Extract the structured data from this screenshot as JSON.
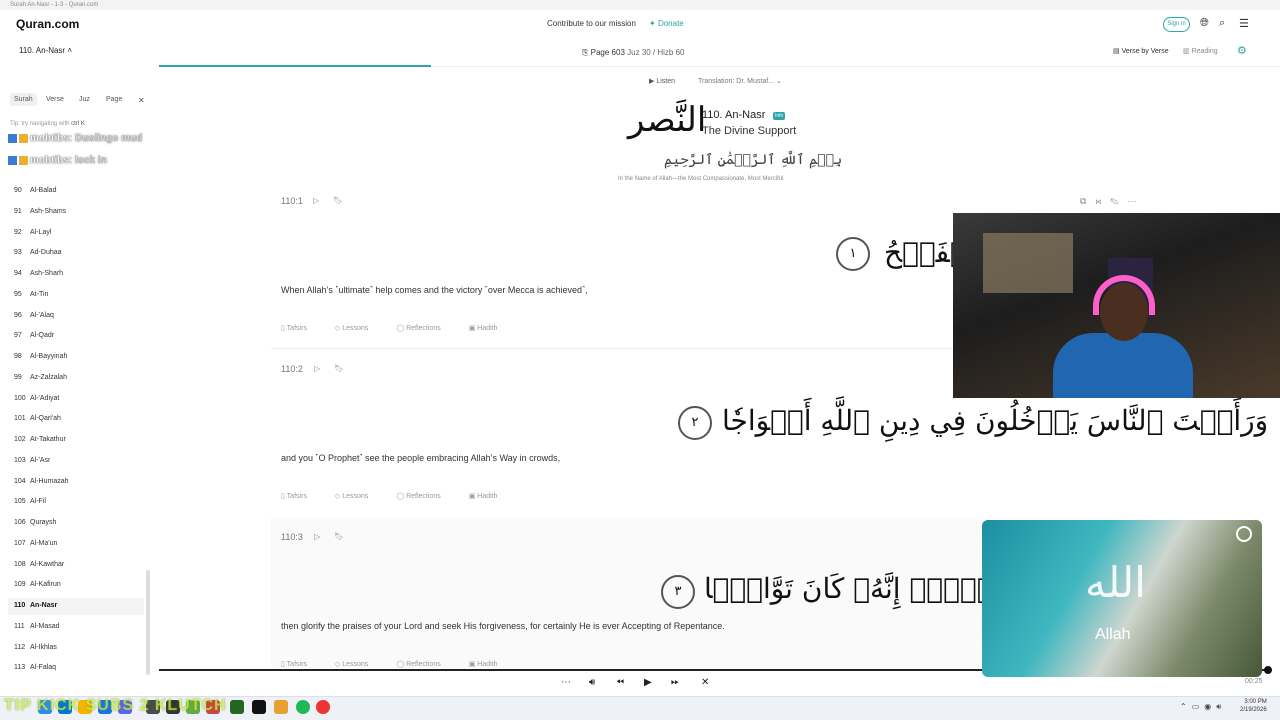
{
  "browser": {
    "title": "Surah An-Nasr - 1-3 - Quran.com"
  },
  "header": {
    "logo": "Quran.com",
    "contribute": "Contribute to our mission",
    "donate": "Donate",
    "signin": "Sign in",
    "surah_select": "110. An-Nasr",
    "page": "Page 603",
    "juz_hizb": "Juz 30 / Hizb 60",
    "verse_by_verse": "Verse by Verse",
    "reading": "Reading",
    "reading_progress": 0.243
  },
  "sidebar": {
    "tabs": [
      "Surah",
      "Verse",
      "Juz",
      "Page"
    ],
    "tip": "Tip: try navigating with",
    "tip_key": "ctrl K",
    "chat": [
      {
        "user": "mobtibs",
        "message": "Duolingo mud"
      },
      {
        "user": "mobtibs",
        "message": "lock in"
      }
    ],
    "items": [
      {
        "num": "90",
        "name": "Al-Balad"
      },
      {
        "num": "91",
        "name": "Ash-Shams"
      },
      {
        "num": "92",
        "name": "Al-Layl"
      },
      {
        "num": "93",
        "name": "Ad-Duhaa"
      },
      {
        "num": "94",
        "name": "Ash-Sharh"
      },
      {
        "num": "95",
        "name": "At-Tin"
      },
      {
        "num": "96",
        "name": "Al-'Alaq"
      },
      {
        "num": "97",
        "name": "Al-Qadr"
      },
      {
        "num": "98",
        "name": "Al-Bayyinah"
      },
      {
        "num": "99",
        "name": "Az-Zalzalah"
      },
      {
        "num": "100",
        "name": "Al-'Adiyat"
      },
      {
        "num": "101",
        "name": "Al-Qari'ah"
      },
      {
        "num": "102",
        "name": "At-Takathur"
      },
      {
        "num": "103",
        "name": "Al-'Asr"
      },
      {
        "num": "104",
        "name": "Al-Humazah"
      },
      {
        "num": "105",
        "name": "Al-Fil"
      },
      {
        "num": "106",
        "name": "Quraysh"
      },
      {
        "num": "107",
        "name": "Al-Ma'un"
      },
      {
        "num": "108",
        "name": "Al-Kawthar"
      },
      {
        "num": "109",
        "name": "Al-Kafirun"
      },
      {
        "num": "110",
        "name": "An-Nasr",
        "active": true
      },
      {
        "num": "111",
        "name": "Al-Masad"
      },
      {
        "num": "112",
        "name": "Al-Ikhlas"
      },
      {
        "num": "113",
        "name": "Al-Falaq"
      }
    ]
  },
  "surah": {
    "listen": "Listen",
    "translation": "Translation: Dr. Mustaf...",
    "calligraphy": "النَّصر",
    "title": "110. An-Nasr",
    "info": "Info",
    "subtitle": "The Divine Support",
    "bismillah_ar": "بِسۡمِ ٱللَّهِ ٱلرَّحۡمَٰنِ ٱلرَّحِيمِ",
    "bismillah_en": "In the Name of Allah—the Most Compassionate, Most Merciful"
  },
  "verses": [
    {
      "key": "110:1",
      "arabic": "لۡفَتۡحُ",
      "marker": "١",
      "translation": "When Allah’s ˹ultimate˺ help comes and the victory ˹over Mecca is achieved˺,"
    },
    {
      "key": "110:2",
      "arabic": "وَرَأَيۡتَ ٱلنَّاسَ يَدۡخُلُونَ فِي دِينِ ٱللَّهِ أَفۡوَاجٗا",
      "marker": "٢",
      "translation": "and you ˹O Prophet˺ see the people embracing Allah’s Way in crowds,"
    },
    {
      "key": "110:3",
      "arabic": "وَٱسۡتَغۡفِرۡهُۚ إِنَّهُۥ كَانَ تَوَّابَۢا",
      "marker": "٣",
      "translation": "then glorify the praises of your Lord and seek His forgiveness, for certainly He is ever Accepting of Repentance."
    }
  ],
  "verse_actions": [
    "Tafsirs",
    "Lessons",
    "Reflections",
    "Hadith"
  ],
  "player": {
    "time": "00:25"
  },
  "overlay": {
    "ar": "الله",
    "label": "Allah"
  },
  "taskbar": {
    "stream_text": "TIP KICK SUBS 2 KLUTCH",
    "clock_time": "3:00 PM",
    "clock_date": "2/19/2026"
  },
  "colors": {
    "accent": "#2ca4ab",
    "overlay_text": "#ffffff",
    "taskbar_overlay": "#c8f046"
  }
}
